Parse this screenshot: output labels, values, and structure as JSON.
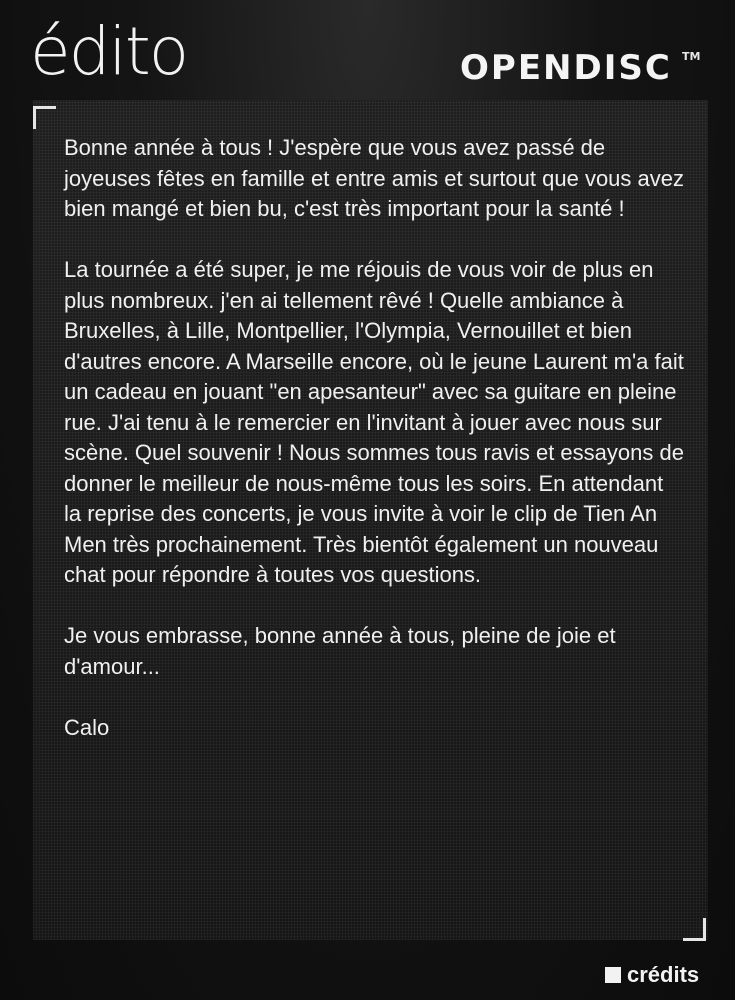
{
  "header": {
    "title": "édito",
    "brand": "OPENDISC",
    "brand_mark": "TM"
  },
  "article": {
    "paragraphs": [
      "Bonne année à tous ! J'espère que vous avez passé de joyeuses fêtes en famille et entre amis et surtout que vous avez bien mangé et bien bu, c'est très important pour la santé !",
      "La tournée a été super, je me réjouis de vous voir de plus en plus nombreux. j'en ai tellement rêvé ! Quelle ambiance à Bruxelles, à Lille, Montpellier, l'Olympia, Vernouillet et bien d'autres encore. A Marseille encore, où le jeune Laurent m'a fait un cadeau en jouant \"en apesanteur\" avec sa guitare en pleine rue. J'ai tenu à le remercier en l'invitant à jouer avec nous sur scène. Quel souvenir ! Nous sommes tous ravis et essayons de donner le meilleur de nous-même tous les soirs. En attendant la reprise des concerts, je vous invite à voir le clip de Tien An Men très prochainement. Très bientôt également un nouveau chat pour répondre à toutes vos questions.",
      "Je vous embrasse, bonne année à tous, pleine de joie et d'amour...",
      "Calo"
    ]
  },
  "footer": {
    "credits_label": "crédits"
  }
}
